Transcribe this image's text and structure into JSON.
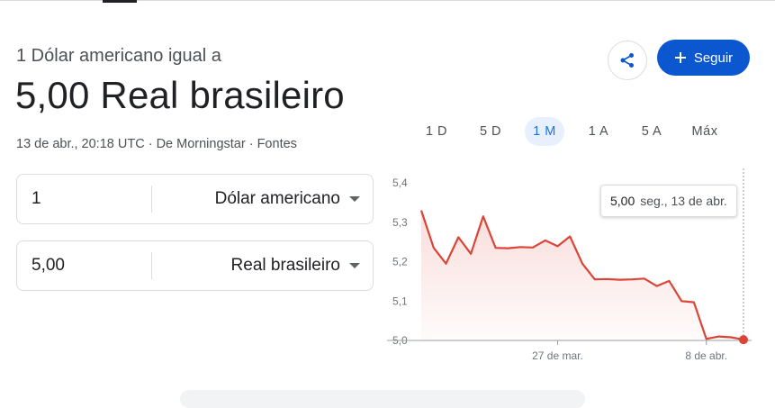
{
  "header": {
    "subtitle": "1 Dólar americano igual a",
    "headline": "5,00 Real brasileiro",
    "timestamp": "13 de abr., 20:18 UTC",
    "source": "De Morningstar",
    "links": "Fontes",
    "separator": " · "
  },
  "actions": {
    "share_icon": "share-icon",
    "follow_label": "Seguir",
    "follow_icon": "plus-icon",
    "accent": "#0b57d0"
  },
  "ranges": [
    {
      "label": "1 D",
      "active": false
    },
    {
      "label": "5 D",
      "active": false
    },
    {
      "label": "1 M",
      "active": true
    },
    {
      "label": "1 A",
      "active": false
    },
    {
      "label": "5 A",
      "active": false
    },
    {
      "label": "Máx",
      "active": false
    }
  ],
  "converter": {
    "from": {
      "amount": "1",
      "currency": "Dólar americano"
    },
    "to": {
      "amount": "5,00",
      "currency": "Real brasileiro"
    }
  },
  "tooltip": {
    "value": "5,00",
    "date": "seg., 13 de abr."
  },
  "chart_data": {
    "type": "line",
    "line_color": "#db4437",
    "ylim": [
      5.0,
      5.4
    ],
    "yticks": [
      "5,0",
      "5,1",
      "5,2",
      "5,3",
      "5,4"
    ],
    "ytick_values": [
      5.0,
      5.1,
      5.2,
      5.3,
      5.4
    ],
    "xticks": [
      {
        "label": "27 de mar.",
        "index": 11
      },
      {
        "label": "8 de abr.",
        "index": 23
      }
    ],
    "series": [
      {
        "values": [
          5.33,
          5.235,
          5.195,
          5.262,
          5.22,
          5.315,
          5.235,
          5.234,
          5.237,
          5.236,
          5.254,
          5.239,
          5.264,
          5.195,
          5.155,
          5.156,
          5.154,
          5.155,
          5.157,
          5.138,
          5.151,
          5.1,
          5.097,
          5.004,
          5.01,
          5.008,
          5.002
        ]
      }
    ],
    "grid": false
  }
}
